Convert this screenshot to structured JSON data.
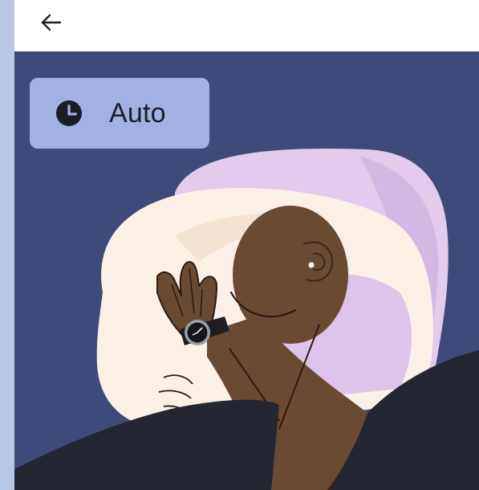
{
  "topbar": {
    "back_icon": "arrow-left-icon"
  },
  "mode_chip": {
    "icon": "clock-icon",
    "label": "Auto"
  },
  "hero": {
    "illustration": "person-sleeping-illustration",
    "watch_icon": "wristwatch-icon"
  },
  "colors": {
    "background": "#404a7a",
    "chip": "#a2b1e2",
    "skin": "#6b4a32",
    "pillow_front": "#fbf0e6",
    "pillow_back": "#e3cbee",
    "blanket": "#242632"
  }
}
